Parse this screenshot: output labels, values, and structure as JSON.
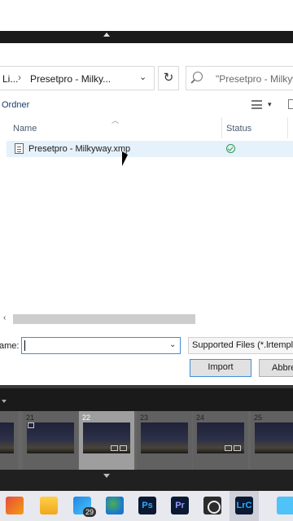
{
  "file_dialog": {
    "breadcrumb": [
      "Li...",
      "Presetpro - Milky..."
    ],
    "search_placeholder": "\"Presetpro - Milkyway\"",
    "toolbar_ordner": "Ordner",
    "column_name": "Name",
    "column_status": "Status",
    "files": [
      {
        "name": "Presetpro - Milkyway.xmp",
        "status_icon": "sync-ok-check-icon"
      }
    ],
    "filename_label": "ame:",
    "filename_value": "",
    "filter_label": "Supported Files (*.lrtemplate",
    "import_button": "Import",
    "cancel_button": "Abbre"
  },
  "filmstrip": {
    "frames": [
      {
        "number": ""
      },
      {
        "number": "21"
      },
      {
        "number": "22",
        "selected": true
      },
      {
        "number": "23"
      },
      {
        "number": "24"
      },
      {
        "number": "25"
      }
    ]
  },
  "taskbar": {
    "apps": [
      "start",
      "file-explorer",
      "store",
      "edge",
      "photoshop",
      "premiere",
      "obs",
      "lightroom-classic",
      "creative-cloud"
    ],
    "store_badge": "29",
    "ps_label": "Ps",
    "pr_label": "Pr",
    "lrc_label": "LrC"
  },
  "colors": {
    "accent": "#3d8fd6",
    "selection": "#e5f1fb",
    "status_ok": "#2e9c4a",
    "lr_dark": "#1a1a1a"
  }
}
